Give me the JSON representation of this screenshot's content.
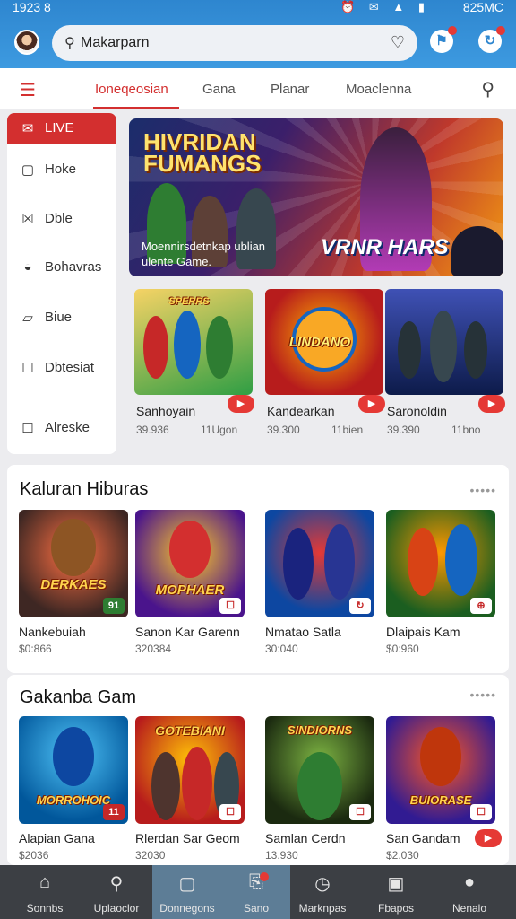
{
  "status": {
    "time": "1923 8",
    "icons": "⏰ ✉ ▲ ▮",
    "clock": "825MC"
  },
  "search": {
    "value": "Makarparn",
    "icon": "search-icon",
    "heart": "heart-icon"
  },
  "tabs": [
    {
      "label": "Ioneqeosian",
      "active": true
    },
    {
      "label": "Gana",
      "active": false
    },
    {
      "label": "Planar",
      "active": false
    },
    {
      "label": "Moaclenna",
      "active": false
    }
  ],
  "sidebar": {
    "items": [
      {
        "label": "LIVE",
        "icon": "live-icon"
      },
      {
        "label": "Hoke",
        "icon": "home-icon"
      },
      {
        "label": "Dble",
        "icon": "grid-icon"
      },
      {
        "label": "Bohavras",
        "icon": "user-icon"
      },
      {
        "label": "Biue",
        "icon": "folder-icon"
      },
      {
        "label": "Dbtesiat",
        "icon": "list-icon"
      },
      {
        "label": "Alreske",
        "icon": "doc-icon"
      }
    ]
  },
  "banner": {
    "title": "HIVRIDAN FUMANGS",
    "caption": "Moennirsdetnkap ublian ulente Game.",
    "logo": "VRNR HARS"
  },
  "featured": [
    {
      "name": "Sanhoyain",
      "meta": "39.936",
      "meta2": "11Ugon",
      "art": "SPERRS",
      "colors": [
        "#2f9e44",
        "#f6d365"
      ]
    },
    {
      "name": "Kandearkan",
      "meta": "39.300",
      "meta2": "11bien",
      "art": "LINDANO",
      "colors": [
        "#b71c1c",
        "#ffb300"
      ]
    },
    {
      "name": "Saronoldin",
      "meta": "39.390",
      "meta2": "11bno",
      "art": "",
      "colors": [
        "#0d1b4a",
        "#3f51b5"
      ]
    }
  ],
  "section1": {
    "title": "Kaluran Hiburas",
    "more": "•••••",
    "items": [
      {
        "name": "Nankebuiah",
        "sub": "$0:866",
        "art": "DERKAES",
        "badge": "91",
        "colors": [
          "#3e2723",
          "#ff7043"
        ]
      },
      {
        "name": "Sanon Kar Garenn",
        "sub": "320384",
        "art": "MOPHAER",
        "badge": "☐",
        "colors": [
          "#4a148c",
          "#ffca28"
        ]
      },
      {
        "name": "Nmatao Satla",
        "sub": "30:040",
        "art": "",
        "badge": "↻",
        "colors": [
          "#0d47a1",
          "#e53935"
        ]
      },
      {
        "name": "Dlaipais Kam",
        "sub": "$0:960",
        "art": "",
        "badge": "⊕",
        "colors": [
          "#1b5e20",
          "#ff9800"
        ]
      }
    ]
  },
  "section2": {
    "title": "Gakanba Gam",
    "more": "•••••",
    "items": [
      {
        "name": "Alapian Gana",
        "sub": "$2036",
        "art": "MORROHOIC",
        "badge": "11",
        "colors": [
          "#01579b",
          "#4fc3f7"
        ]
      },
      {
        "name": "Rlerdan Sar Geom",
        "sub": "32030",
        "art": "GOTEBIANI",
        "badge": "☐",
        "colors": [
          "#b71c1c",
          "#ffc107"
        ]
      },
      {
        "name": "Samlan Cerdn",
        "sub": "13.930",
        "art": "SINDIORNS",
        "badge": "☐",
        "colors": [
          "#1b2a10",
          "#7cb342"
        ]
      },
      {
        "name": "San Gandam",
        "sub": "$2.030",
        "art": "BUIORASE",
        "badge": "☐",
        "colors": [
          "#311b92",
          "#ff5722"
        ]
      }
    ]
  },
  "bottomnav": [
    {
      "label": "Sonnbs",
      "icon": "⌂",
      "iconname": "home-icon",
      "active": false
    },
    {
      "label": "Uplaoclor",
      "icon": "⚲",
      "iconname": "search-icon",
      "active": false
    },
    {
      "label": "Donnegons",
      "icon": "▢",
      "iconname": "library-icon",
      "active": true
    },
    {
      "label": "Sano",
      "icon": "⎘",
      "iconname": "store-icon",
      "active": false,
      "dot": true
    },
    {
      "label": "Marknpas",
      "icon": "◷",
      "iconname": "clock-icon",
      "active": false
    },
    {
      "label": "Fbapos",
      "icon": "▣",
      "iconname": "media-icon",
      "active": false
    },
    {
      "label": "Nenalo",
      "icon": "●",
      "iconname": "profile-icon",
      "active": false
    }
  ]
}
